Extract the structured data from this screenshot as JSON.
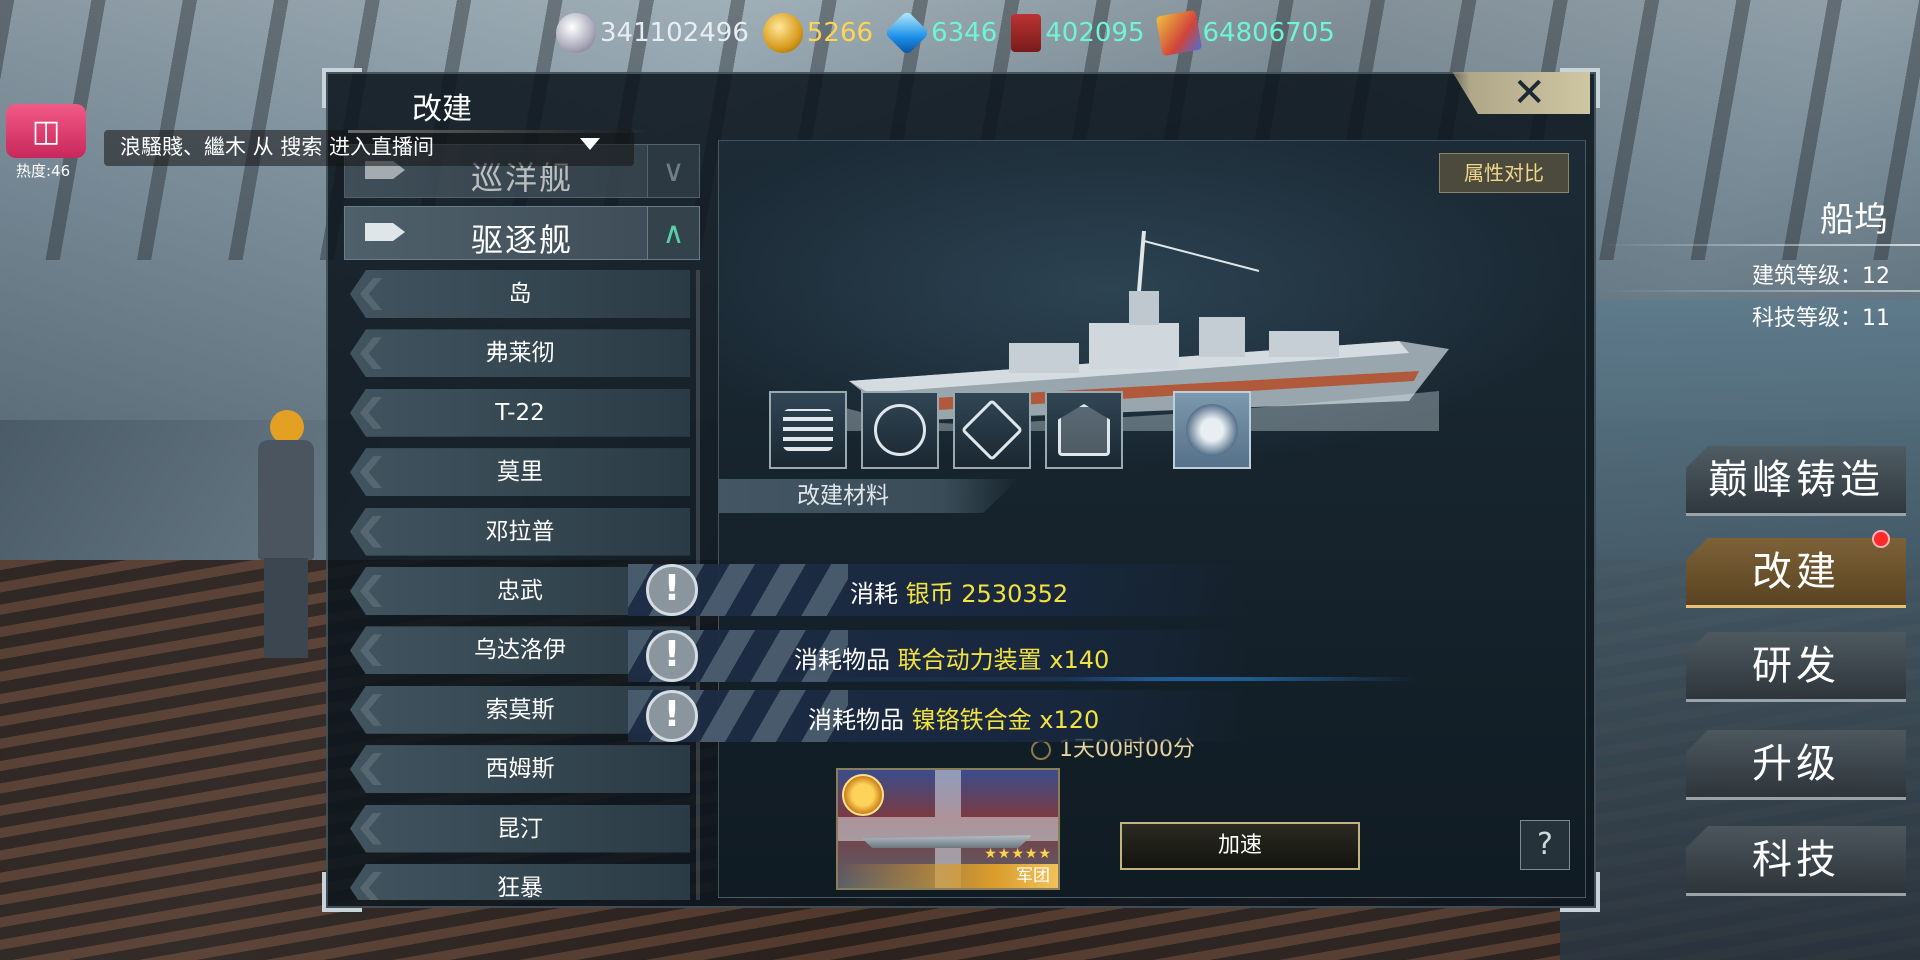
{
  "currencies": [
    {
      "icon": "silver-coin-icon",
      "value": "341102496"
    },
    {
      "icon": "gold-coin-icon",
      "value": "5266"
    },
    {
      "icon": "diamond-icon",
      "value": "6346"
    },
    {
      "icon": "oil-barrel-icon",
      "value": "402095"
    },
    {
      "icon": "parts-icon",
      "value": "64806705"
    }
  ],
  "stream": {
    "heat": "热度:46",
    "message": "浪騷賤、繼木 从 搜索 进入直播间"
  },
  "panel": {
    "title": "改建",
    "close": "✕",
    "compare": "属性对比",
    "categories": {
      "cruiser": "巡洋舰",
      "destroyer": "驱逐舰"
    },
    "ships": [
      "岛",
      "弗莱彻",
      "T-22",
      "莫里",
      "邓拉普",
      "忠武",
      "乌达洛伊",
      "索莫斯",
      "西姆斯",
      "昆汀",
      "狂暴"
    ],
    "materials_header": "改建材料",
    "requirements": [
      {
        "prefix": "消耗",
        "highlight": "银币 2530352"
      },
      {
        "prefix": "消耗物品",
        "highlight": "联合动力装置 x140"
      },
      {
        "prefix": "消耗物品",
        "highlight": "镍铬铁合金 x120"
      }
    ],
    "timer": "1天00时00分",
    "card_label": "军团",
    "card_stars": "★★★★★",
    "speed_up": "加速",
    "help": "?"
  },
  "dock": {
    "title": "船坞",
    "building_level": "建筑等级：12",
    "tech_level": "科技等级：11",
    "buttons": [
      "巅峰铸造",
      "改建",
      "研发",
      "升级",
      "科技"
    ]
  },
  "colors": {
    "highlight": "#f2e240",
    "active_tab": "#7d6238",
    "accent_teal": "#6ff5d6"
  }
}
